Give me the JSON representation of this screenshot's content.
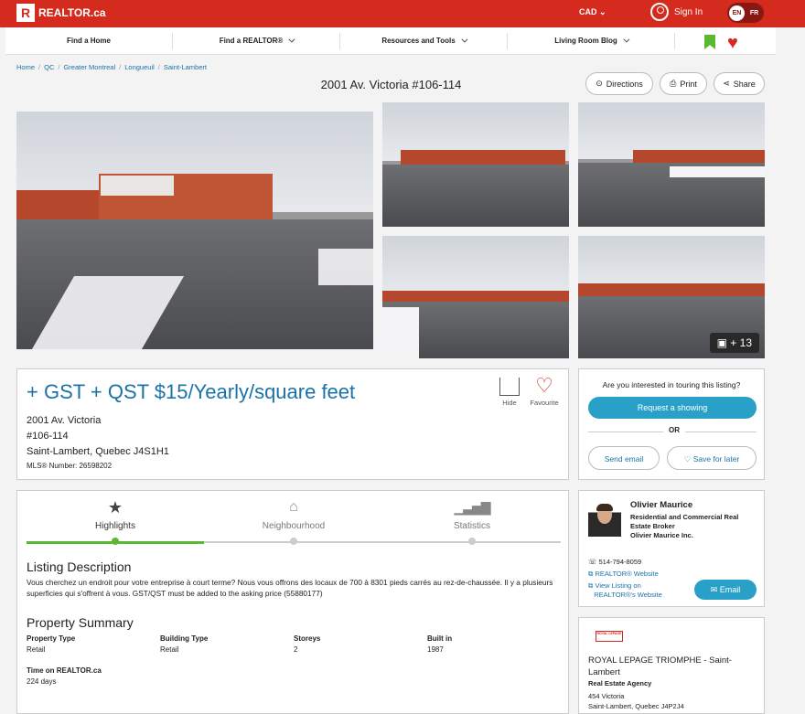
{
  "header": {
    "logo_text": "REALTOR.ca",
    "currency": "CAD",
    "signin": "Sign In",
    "lang_en": "EN",
    "lang_fr": "FR"
  },
  "nav": {
    "items": [
      "Find a Home",
      "Find a REALTOR®",
      "Resources and Tools",
      "Living Room Blog"
    ]
  },
  "breadcrumb": [
    "Home",
    "QC",
    "Greater Montreal",
    "Longueuil",
    "Saint-Lambert"
  ],
  "listing": {
    "title": "2001 Av. Victoria #106-114",
    "price": "+ GST + QST $15/Yearly/square feet",
    "address_line1": "2001 Av. Victoria",
    "address_line2": "#106-114",
    "address_line3": "Saint-Lambert, Quebec J4S1H1",
    "mls": "MLS® Number: 26598202",
    "hide_label": "Hide",
    "favourite_label": "Favourite",
    "photo_count": "+ 13"
  },
  "actions": {
    "directions": "Directions",
    "print": "Print",
    "share": "Share"
  },
  "tour": {
    "question": "Are you interested in touring this listing?",
    "request": "Request a showing",
    "or": "OR",
    "send_email": "Send email",
    "save": "Save for later"
  },
  "tabs": [
    {
      "label": "Highlights",
      "icon": "star-icon"
    },
    {
      "label": "Neighbourhood",
      "icon": "city-icon"
    },
    {
      "label": "Statistics",
      "icon": "bar-chart-icon"
    }
  ],
  "description": {
    "heading": "Listing Description",
    "text": "Vous cherchez un endroit pour votre entreprise à court terme? Nous vous offrons des locaux de 700 à 8301 pieds carrés au rez-de-chaussée. Il y a plusieurs superficies qui s'offrent à vous. GST/QST must be added to the asking price (55880177)"
  },
  "summary": {
    "heading": "Property Summary",
    "fields": [
      {
        "label": "Property Type",
        "value": "Retail"
      },
      {
        "label": "Building Type",
        "value": "Retail"
      },
      {
        "label": "Storeys",
        "value": "2"
      },
      {
        "label": "Built in",
        "value": "1987"
      },
      {
        "label": "Time on REALTOR.ca",
        "value": "224 days"
      }
    ]
  },
  "agent": {
    "name": "Olivier Maurice",
    "title": "Residential and Commercial Real Estate Broker",
    "company": "Olivier Maurice Inc.",
    "phone": "514-794-8059",
    "website": "REALTOR® Website",
    "view_listing": "View Listing on",
    "view_listing2": "REALTOR®'s Website",
    "email": "Email"
  },
  "brokerage": {
    "logo_text": "ROYAL LEPAGE",
    "name": "ROYAL LEPAGE TRIOMPHE - Saint-Lambert",
    "type": "Real Estate Agency",
    "street": "454 Victoria",
    "city": "Saint-Lambert, Quebec J4P2J4"
  },
  "colors": {
    "brand": "#d52b1e",
    "accent": "#29a0c8",
    "green": "#5bb832"
  }
}
